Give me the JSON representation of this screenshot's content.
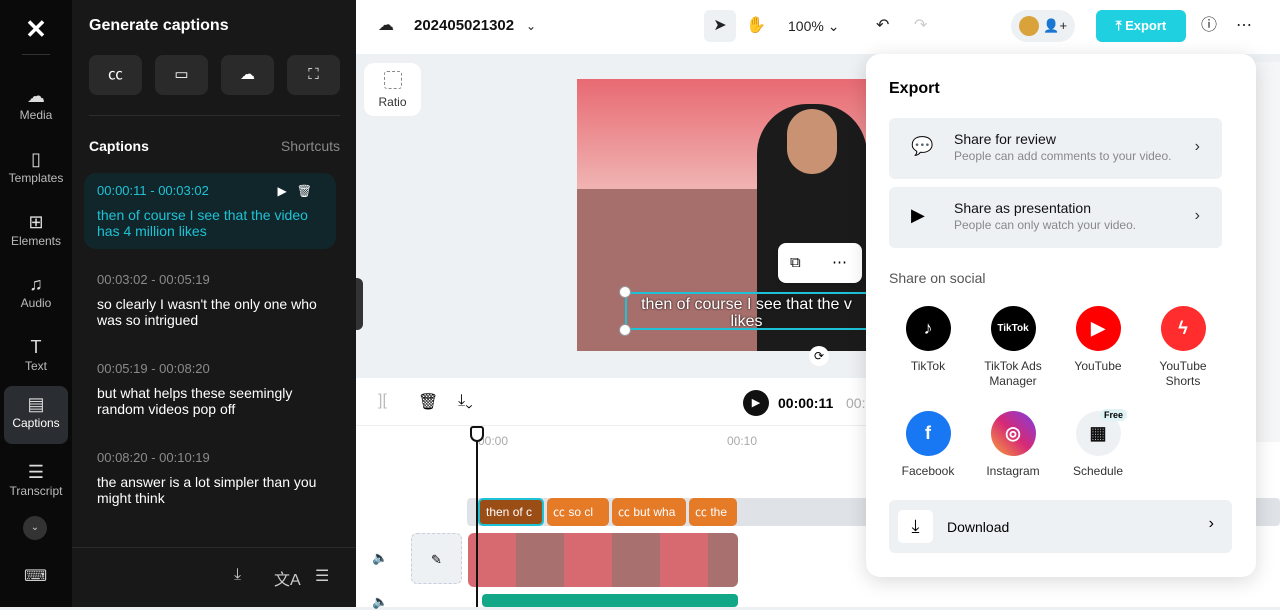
{
  "rail": {
    "items": [
      {
        "label": "Media",
        "icon": "cloud-upload-icon"
      },
      {
        "label": "Templates",
        "icon": "templates-icon"
      },
      {
        "label": "Elements",
        "icon": "elements-icon"
      },
      {
        "label": "Audio",
        "icon": "music-icon"
      },
      {
        "label": "Text",
        "icon": "text-icon"
      },
      {
        "label": "Captions",
        "icon": "captions-icon",
        "active": true
      },
      {
        "label": "Transcript",
        "icon": "transcript-icon"
      }
    ]
  },
  "panel": {
    "title": "Generate captions",
    "captions_heading": "Captions",
    "shortcuts": "Shortcuts",
    "captions": [
      {
        "time": "00:00:11 - 00:03:02",
        "text": "then of course I see that the video has 4 million likes",
        "selected": true
      },
      {
        "time": "00:03:02 - 00:05:19",
        "text": "so clearly I wasn't the only one who was so intrigued"
      },
      {
        "time": "00:05:19 - 00:08:20",
        "text": "but what helps these seemingly random videos pop off"
      },
      {
        "time": "00:08:20 - 00:10:19",
        "text": "the answer is a lot simpler than you might think"
      }
    ]
  },
  "top": {
    "project": "202405021302",
    "zoom": "100%",
    "export": "Export"
  },
  "canvas": {
    "ratio": "Ratio",
    "subtitle": "then of course I see that the v likes"
  },
  "timeline": {
    "current": "00:00:11",
    "total_partial": "00:",
    "ticks": [
      "00:00",
      "00:10"
    ],
    "clips": [
      "then of c",
      "so cl",
      "but wha",
      "the"
    ]
  },
  "export": {
    "title": "Export",
    "share_review": {
      "title": "Share for review",
      "sub": "People can add comments to your video."
    },
    "share_presentation": {
      "title": "Share as presentation",
      "sub": "People can only watch your video."
    },
    "social_heading": "Share on social",
    "social": [
      {
        "label": "TikTok",
        "color": "#000000"
      },
      {
        "label": "TikTok Ads Manager",
        "color": "#000000"
      },
      {
        "label": "YouTube",
        "color": "#ff0000"
      },
      {
        "label": "YouTube Shorts",
        "color": "#ff2d2d"
      },
      {
        "label": "Facebook",
        "color": "#1877f2"
      },
      {
        "label": "Instagram",
        "color": "#d62976"
      },
      {
        "label": "Schedule",
        "color": "#eef1f4"
      }
    ],
    "free_badge": "Free",
    "download": "Download"
  },
  "colors": {
    "accent": "#1fd0e0",
    "caption_clip": "#e57a27"
  }
}
